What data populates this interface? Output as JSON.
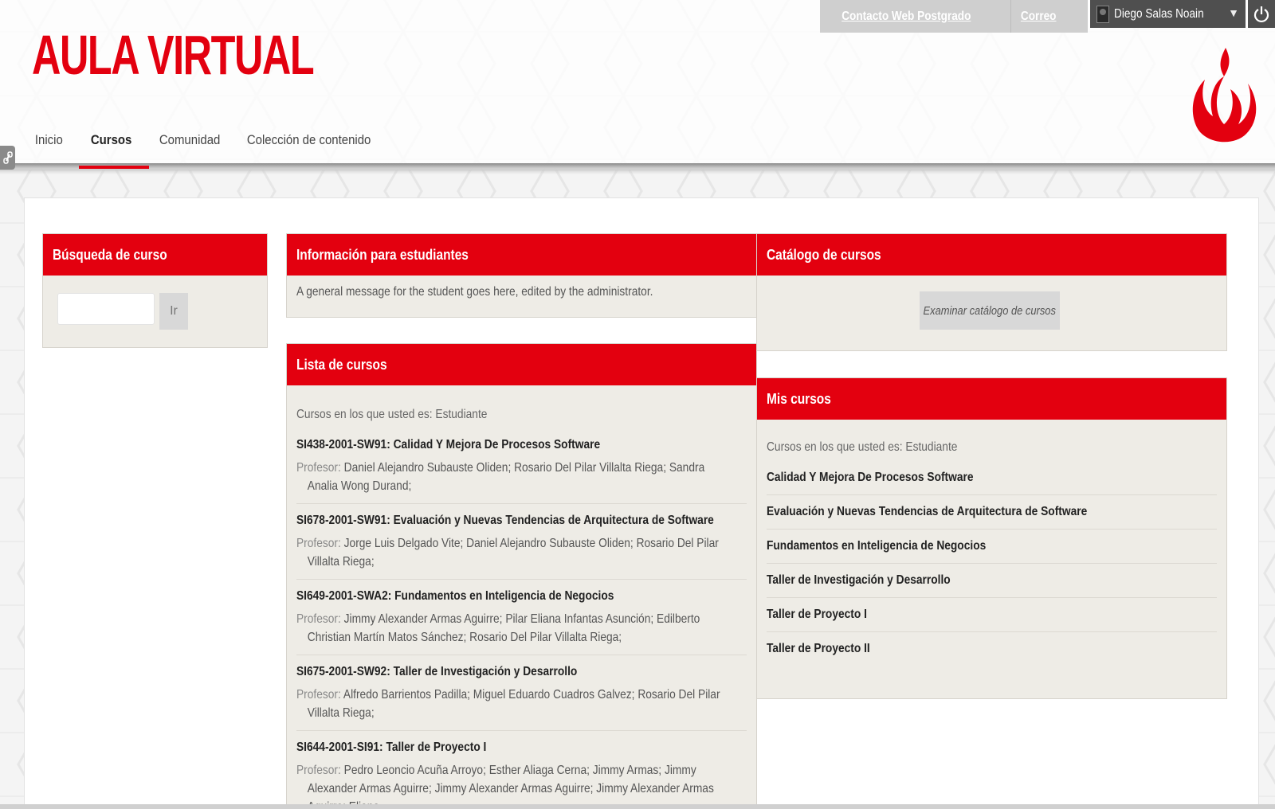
{
  "brand": {
    "logo_text": "AULA VIRTUAL",
    "accent": "#e3000f"
  },
  "topbar": {
    "links": [
      "Contacto Web Postgrado",
      "Correo"
    ],
    "user_name": "Diego Salas Noain",
    "caret": "▼"
  },
  "nav": {
    "items": [
      "Inicio",
      "Cursos",
      "Comunidad",
      "Colección de contenido"
    ],
    "active": "Cursos"
  },
  "search_module": {
    "title": "Búsqueda de curso",
    "button_label": "Ir",
    "input_value": ""
  },
  "info_module": {
    "title": "Información para estudiantes",
    "message": "A general message for the student goes here, edited by the administrator."
  },
  "catalog_module": {
    "title": "Catálogo de cursos",
    "button_label": "Examinar catálogo de cursos"
  },
  "course_list": {
    "title": "Lista de cursos",
    "role_line": "Cursos en los que usted es: Estudiante",
    "prof_label": "Profesor:",
    "courses": [
      {
        "code_title": "SI438-2001-SW91: Calidad Y Mejora De Procesos Software",
        "professors": "Daniel Alejandro Subauste Oliden;  Rosario Del Pilar Villalta Riega;  Sandra Analia Wong Durand;"
      },
      {
        "code_title": "SI678-2001-SW91: Evaluación y Nuevas Tendencias de Arquitectura de Software",
        "professors": "Jorge Luis Delgado Vite;  Daniel Alejandro Subauste Oliden;  Rosario Del Pilar Villalta Riega;"
      },
      {
        "code_title": "SI649-2001-SWA2: Fundamentos en Inteligencia de Negocios",
        "professors": "Jimmy Alexander Armas Aguirre;  Pilar Eliana Infantas Asunción;  Edilberto Christian Martín Matos Sánchez;  Rosario Del Pilar Villalta Riega;"
      },
      {
        "code_title": "SI675-2001-SW92: Taller de Investigación y Desarrollo",
        "professors": "Alfredo Barrientos Padilla;  Miguel Eduardo Cuadros Galvez;  Rosario Del Pilar Villalta Riega;"
      },
      {
        "code_title": "SI644-2001-SI91: Taller de Proyecto I",
        "professors": "Pedro Leoncio Acuña Arroyo;  Esther Aliaga Cerna;  Jimmy Armas;  Jimmy Alexander Armas Aguirre;  Jimmy Alexander Armas Aguirre;  Jimmy Alexander Armas Aguirre;  Eliana"
      }
    ]
  },
  "my_courses": {
    "title": "Mis cursos",
    "role_line": "Cursos en los que usted es: Estudiante",
    "items": [
      "Calidad Y Mejora De Procesos Software",
      "Evaluación y Nuevas Tendencias de Arquitectura de Software",
      "Fundamentos en Inteligencia de Negocios",
      "Taller de Investigación y Desarrollo",
      "Taller de Proyecto I",
      "Taller de Proyecto II"
    ]
  }
}
